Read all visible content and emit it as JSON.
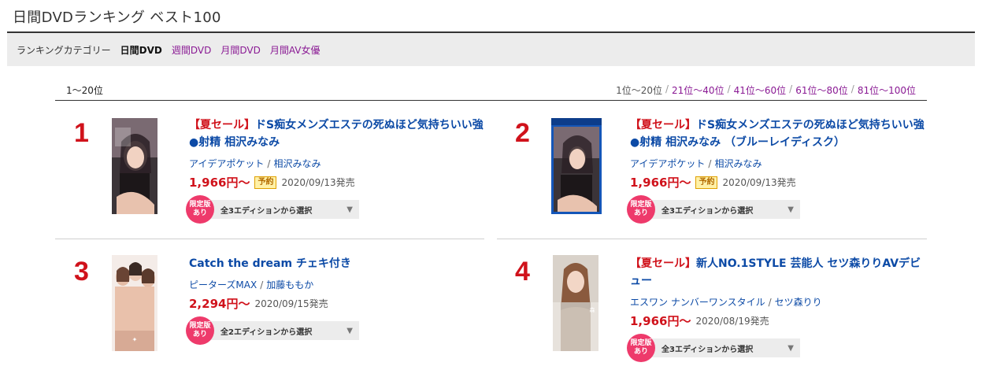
{
  "page_title": "日間DVDランキング ベスト100",
  "category_bar": {
    "label": "ランキングカテゴリー",
    "current": "日間DVD",
    "links": [
      "週間DVD",
      "月間DVD",
      "月間AV女優"
    ]
  },
  "range_current": "1〜20位",
  "pager": {
    "current": "1位〜20位",
    "links": [
      "21位〜40位",
      "41位〜60位",
      "61位〜80位",
      "81位〜100位"
    ],
    "separator": "/"
  },
  "items": [
    {
      "rank": "1",
      "sale_tag": "【夏セール】",
      "title": "ドS痴女メンズエステの死ぬほど気持ちいい強●射精 相沢みなみ",
      "maker": "アイデアポケット",
      "actress": "相沢みなみ",
      "price": "1,966円〜",
      "preorder": "予約",
      "release": "2020/09/13発売",
      "badge_line1": "限定版",
      "badge_line2": "あり",
      "edition_select": "全3エディションから選択"
    },
    {
      "rank": "2",
      "sale_tag": "【夏セール】",
      "title": "ドS痴女メンズエステの死ぬほど気持ちいい強●射精 相沢みなみ （ブルーレイディスク）",
      "maker": "アイデアポケット",
      "actress": "相沢みなみ",
      "price": "1,966円〜",
      "preorder": "予約",
      "release": "2020/09/13発売",
      "badge_line1": "限定版",
      "badge_line2": "あり",
      "edition_select": "全3エディションから選択"
    },
    {
      "rank": "3",
      "sale_tag": "",
      "title": "Catch the dream チェキ付き",
      "maker": "ピーターズMAX",
      "actress": "加藤ももか",
      "price": "2,294円〜",
      "preorder": "",
      "release": "2020/09/15発売",
      "badge_line1": "限定版",
      "badge_line2": "あり",
      "edition_select": "全2エディションから選択"
    },
    {
      "rank": "4",
      "sale_tag": "【夏セール】",
      "title": "新人NO.1STYLE 芸能人 セツ森りりAVデビュー",
      "maker": "エスワン ナンバーワンスタイル",
      "actress": "セツ森りり",
      "price": "1,966円〜",
      "preorder": "",
      "release": "2020/08/19発売",
      "badge_line1": "限定版",
      "badge_line2": "あり",
      "edition_select": "全3エディションから選択"
    }
  ],
  "colors": {
    "rank_red": "#d0121b",
    "title_blue": "#0c4aa6",
    "category_link_purple": "#8a1a94",
    "badge_pink": "#ee3a6b"
  }
}
